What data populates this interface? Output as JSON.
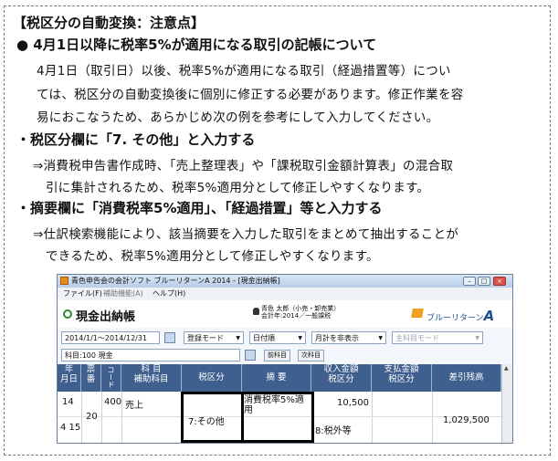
{
  "heading": "【税区分の自動変換：注意点】",
  "section1": {
    "title": "●  4月1日以降に税率5%が適用になる取引の記帳について",
    "lines": [
      "4月1日（取引日）以後、税率5%が適用になる取引（経過措置等）につい",
      "ては、税区分の自動変換後に個別に修正する必要があります。修正作業を容",
      "易におこなうため、あらかじめ次の例を参考にして入力してください。"
    ]
  },
  "section2": {
    "title": "・税区分欄に「7.  その他」と入力する",
    "lines": [
      "⇒消費税申告書作成時、「売上整理表」や「課税取引金額計算表」の混合取",
      "引に集計されるため、税率5%適用分として修正しやすくなります。"
    ]
  },
  "section3": {
    "title": "・摘要欄に「消費税率5%適用」、「経過措置」等と入力する",
    "lines": [
      "⇒仕訳検索機能により、該当摘要を入力した取引をまとめて抽出することが",
      "できるため、税率5%適用分として修正しやすくなります。"
    ]
  },
  "app": {
    "window_title": "青色申告会の会計ソフト ブルーリターンA  2014 - [現金出納帳]",
    "menu": [
      "ファイル(F)",
      "補助機能(A)",
      "ヘルプ(H)"
    ],
    "page_title": "現金出納帳",
    "user_line1": "青色 太郎（小売・卸売業）",
    "user_line2": "会計年:2014／一般課税",
    "brand": "ブルーリターン",
    "brand_letter": "A",
    "toolbar": {
      "date_range": "2014/1/1〜2014/12/31",
      "mode": "登録モード",
      "sort": "日付順",
      "month_filter": "月計を非表示",
      "subject_mode": "主科目モード"
    },
    "account_label": "科目:100 現金",
    "prev_button": "前科目",
    "next_button": "次科目",
    "columns": [
      "年",
      "月日",
      "票",
      "番",
      "コード",
      "科 目",
      "補助科目",
      "税区分",
      "摘 要",
      "収入金額",
      "税区分",
      "支払金額",
      "税区分",
      "差引残高"
    ],
    "row": {
      "year": "14",
      "month_day": "4 15",
      "voucher": "20",
      "code": "400",
      "account": "売上",
      "tax_class": "7:その他",
      "memo": "消費税率5%適用",
      "income": "10,500",
      "income_tax": "8:税外等",
      "balance": "1,029,500"
    }
  },
  "colors": {
    "header_bg": "#3f5f8e",
    "highlight_border": "#000000",
    "accent_green": "#2f8e2f"
  }
}
